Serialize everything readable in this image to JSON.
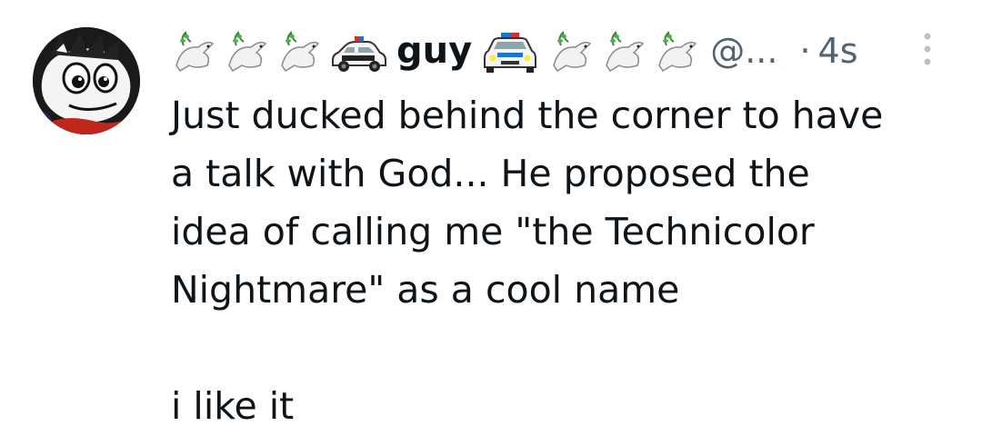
{
  "post": {
    "author": {
      "display_name": "guy",
      "handle": "@...",
      "avatar_icon": "cartoon-avatar",
      "name_emojis_before": [
        "dove-icon",
        "dove-icon",
        "dove-icon",
        "police-car-icon"
      ],
      "name_emojis_after": [
        "police-car-front-icon",
        "dove-icon",
        "dove-icon",
        "dove-icon"
      ]
    },
    "separator": "·",
    "timestamp": "4s",
    "body_lines": [
      "Just ducked behind the corner to have",
      "a talk with God... He proposed the",
      "idea of calling me \"the Technicolor",
      "Nightmare\" as a cool name"
    ],
    "body_last_line": "i like it"
  },
  "colors": {
    "text_primary": "#0f1419",
    "text_secondary": "#536471",
    "background": "#ffffff"
  },
  "icons": {
    "more": "more-vertical-icon"
  }
}
